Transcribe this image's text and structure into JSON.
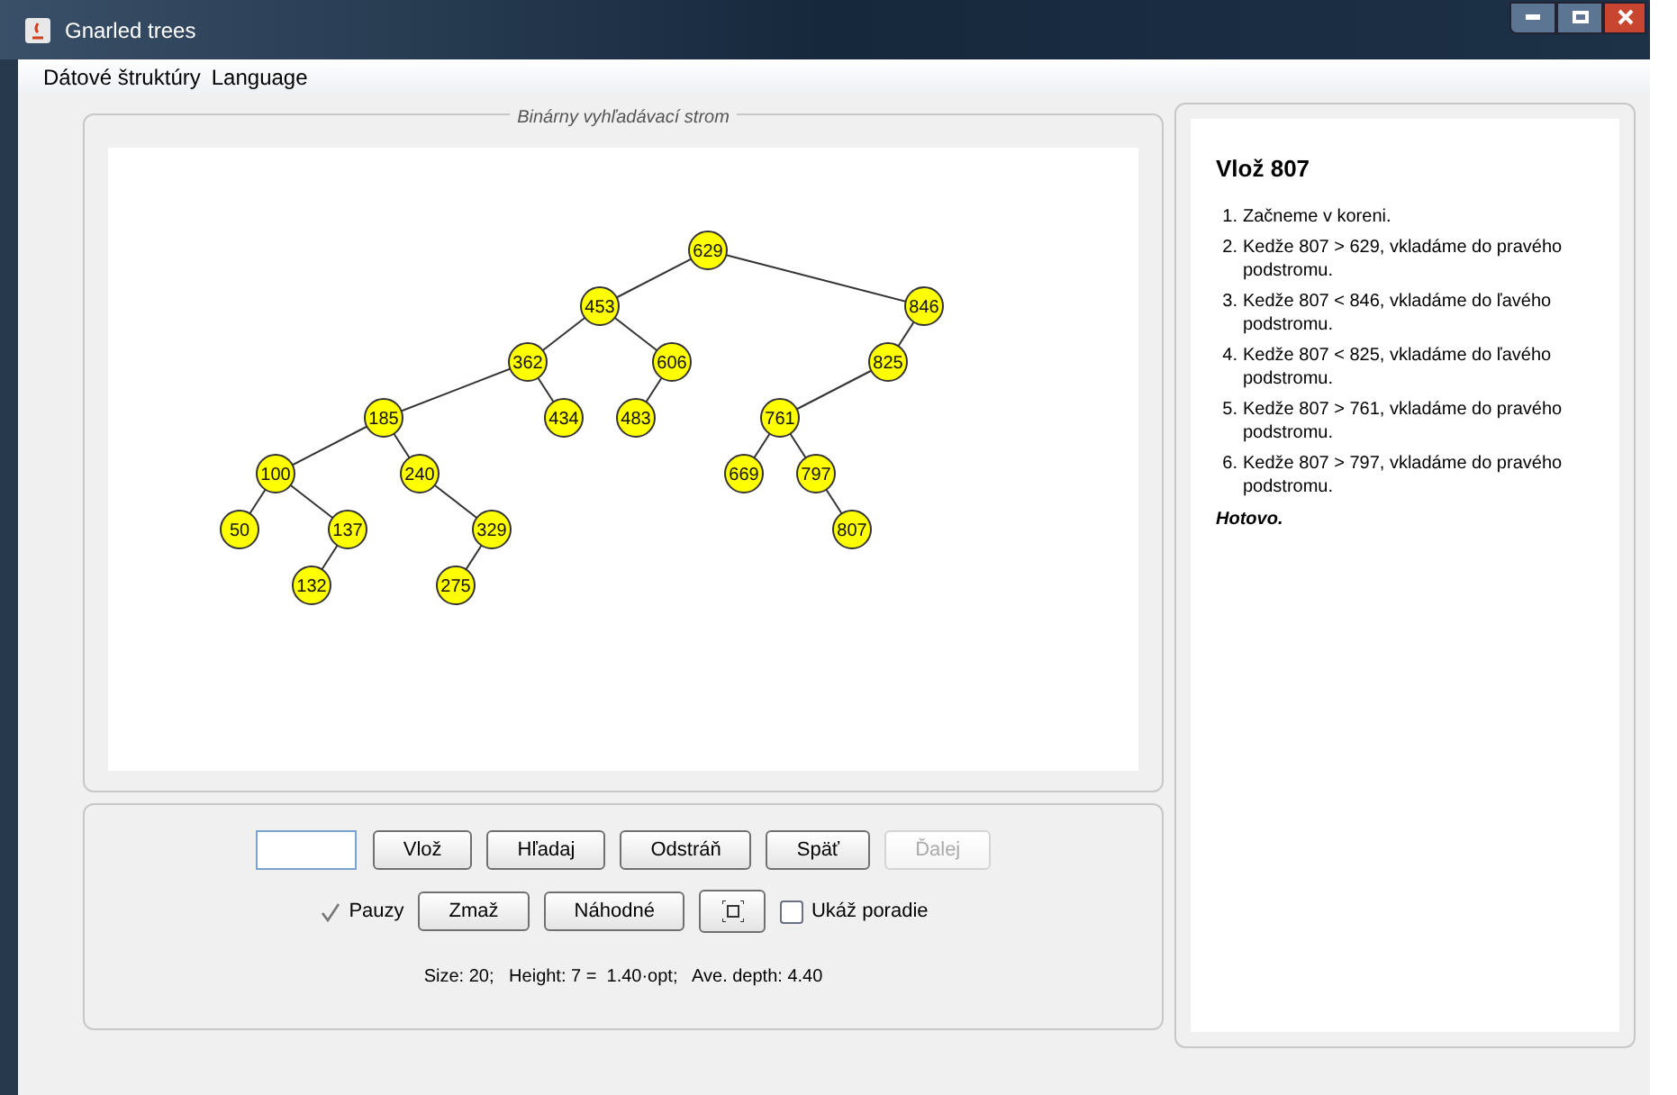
{
  "window": {
    "title": "Gnarled trees"
  },
  "menu": [
    "Dátové štruktúry",
    "Language"
  ],
  "tree_panel": {
    "title": "Binárny vyhľadávací strom",
    "root": {
      "value": "629",
      "children": [
        {
          "kind": "left",
          "value": "453",
          "children": [
            {
              "kind": "left",
              "value": "362",
              "children": [
                {
                  "kind": "left",
                  "value": "185",
                  "children": [
                    {
                      "kind": "left",
                      "value": "100",
                      "children": [
                        {
                          "kind": "left",
                          "value": "50"
                        },
                        {
                          "kind": "right",
                          "value": "137",
                          "children": [
                            {
                              "kind": "left",
                              "value": "132"
                            }
                          ]
                        }
                      ]
                    },
                    {
                      "kind": "right",
                      "value": "240",
                      "children": [
                        {
                          "kind": "right",
                          "value": "329",
                          "children": [
                            {
                              "kind": "left",
                              "value": "275"
                            }
                          ]
                        }
                      ]
                    }
                  ]
                },
                {
                  "kind": "right",
                  "value": "434"
                }
              ]
            },
            {
              "kind": "right",
              "value": "606",
              "children": [
                {
                  "kind": "left",
                  "value": "483"
                }
              ]
            }
          ]
        },
        {
          "kind": "right",
          "value": "846",
          "children": [
            {
              "kind": "left",
              "value": "825",
              "children": [
                {
                  "kind": "left",
                  "value": "761",
                  "children": [
                    {
                      "kind": "left",
                      "value": "669"
                    },
                    {
                      "kind": "right",
                      "value": "797",
                      "children": [
                        {
                          "kind": "right",
                          "value": "807"
                        }
                      ]
                    }
                  ]
                }
              ]
            }
          ]
        }
      ]
    }
  },
  "controls": {
    "row1": [
      {
        "label": "Vlož",
        "disabled": false
      },
      {
        "label": "Hľadaj",
        "disabled": false
      },
      {
        "label": "Odstráň",
        "disabled": false
      },
      {
        "label": "Späť",
        "disabled": false
      },
      {
        "label": "Ďalej",
        "disabled": true
      }
    ],
    "pause": {
      "label": "Pauzy",
      "checked": true
    },
    "row2": [
      {
        "label": "Zmaž"
      },
      {
        "label": "Náhodné"
      }
    ],
    "show_order": {
      "label": "Ukáž poradie",
      "checked": false
    },
    "stats": "Size: 20;   Height: 7 =  1.40·opt;   Ave. depth: 4.40"
  },
  "explanation": {
    "title": "Vlož 807",
    "steps": [
      {
        "number": "1.",
        "text": "Začneme v koreni."
      },
      {
        "number": "2.",
        "text": "Kedže 807 > 629, vkladáme do pravého podstromu."
      },
      {
        "number": "3.",
        "text": "Kedže 807 < 846, vkladáme do ľavého podstromu."
      },
      {
        "number": "4.",
        "text": "Kedže 807 < 825, vkladáme do ľavého podstromu."
      },
      {
        "number": "5.",
        "text": "Kedže 807 > 761, vkladáme do pravého podstromu."
      },
      {
        "number": "6.",
        "text": "Kedže 807 > 797, vkladáme do pravého podstromu."
      }
    ],
    "done": "Hotovo."
  }
}
